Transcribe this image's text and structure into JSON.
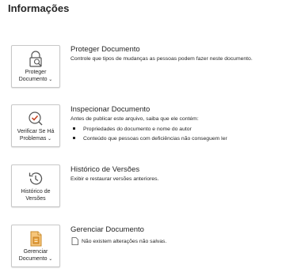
{
  "page_title": "Informações",
  "sections": [
    {
      "tile_label_1": "Proteger",
      "tile_label_2": "Documento",
      "title": "Proteger Documento",
      "description": "Controle que tipos de mudanças as pessoas podem fazer neste documento.",
      "icon": "lock-search-icon"
    },
    {
      "tile_label_1": "Verificar Se Há",
      "tile_label_2": "Problemas",
      "title": "Inspecionar Documento",
      "description": "Antes de publicar este arquivo, saiba que ele contém:",
      "bullets": [
        "Propriedades do documento e nome do autor",
        "Conteúdo que pessoas com deficiências não conseguem ler"
      ],
      "icon": "inspect-document-icon"
    },
    {
      "tile_label_1": "Histórico de",
      "tile_label_2": "Versões",
      "title": "Histórico de Versões",
      "description": "Exibir e restaurar versões anteriores.",
      "icon": "history-icon"
    },
    {
      "tile_label_1": "Gerenciar",
      "tile_label_2": "Documento",
      "title": "Gerenciar Documento",
      "description": "Não existem alterações não salvas.",
      "icon": "manage-document-icon"
    }
  ],
  "colors": {
    "text": "#262626",
    "accent_red": "#c43e1c",
    "accent_orange": "#e8a33d"
  }
}
